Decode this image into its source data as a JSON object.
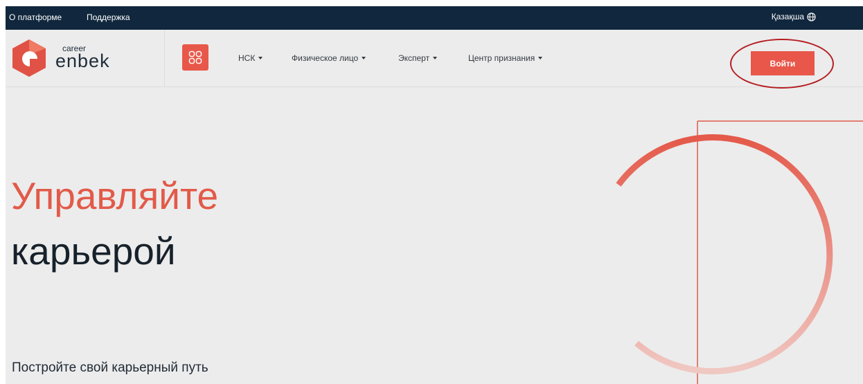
{
  "topbar": {
    "links": [
      "О платформе",
      "Поддержка"
    ],
    "language": "Қазақша"
  },
  "header": {
    "logo": {
      "small": "career",
      "large": "enbek"
    },
    "nav": [
      "НСК",
      "Физическое лицо",
      "Эксперт",
      "Центр признания"
    ],
    "login_label": "Войти"
  },
  "hero": {
    "title_line1": "Управляйте",
    "title_line2": "карьерой",
    "subtitle": "Постройте свой карьерный путь"
  },
  "colors": {
    "accent": "#e8574a",
    "topbar": "#10273d",
    "highlight": "#b51e22"
  },
  "icons": [
    "logo-hexagon-icon",
    "apps-grid-icon",
    "globe-icon",
    "caret-down-icon"
  ]
}
